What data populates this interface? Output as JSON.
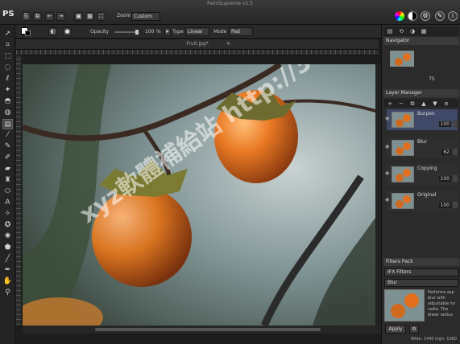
{
  "app": {
    "short_name": "PS",
    "title": "PaintSupreme v1.5"
  },
  "toolbar_top": {
    "zoom_label": "Zoom",
    "zoom_value": "Custom"
  },
  "options": {
    "opacity_label": "Opacity",
    "opacity_value": "100",
    "opacity_unit": "%",
    "type_label": "Type",
    "type_value": "Linear",
    "mode_label": "Mode",
    "mode_value": "Pad"
  },
  "document": {
    "tab_title": "Fruit.jpg*"
  },
  "navigator": {
    "title": "Navigator",
    "zoom": "75"
  },
  "layers": {
    "title": "Layer Manager",
    "items": [
      {
        "name": "Burpen",
        "value": "100"
      },
      {
        "name": "Blur",
        "value": "62"
      },
      {
        "name": "Copying",
        "value": "100"
      },
      {
        "name": "Original",
        "value": "100"
      }
    ]
  },
  "filters": {
    "title": "Filters Pack",
    "category": "IFX Filters",
    "filter": "Blur",
    "description": "Performs sep blur with adjustable ho radia. The blwar radius",
    "apply_label": "Apply"
  },
  "status": {
    "text": "Wide: 1440 high: 1080"
  },
  "watermark": {
    "text": "xyz軟體補給站 http://31.to"
  },
  "colors": {
    "accent": "#3f4865",
    "fruit": "#e06a1c",
    "background": "#1d1d1d"
  }
}
